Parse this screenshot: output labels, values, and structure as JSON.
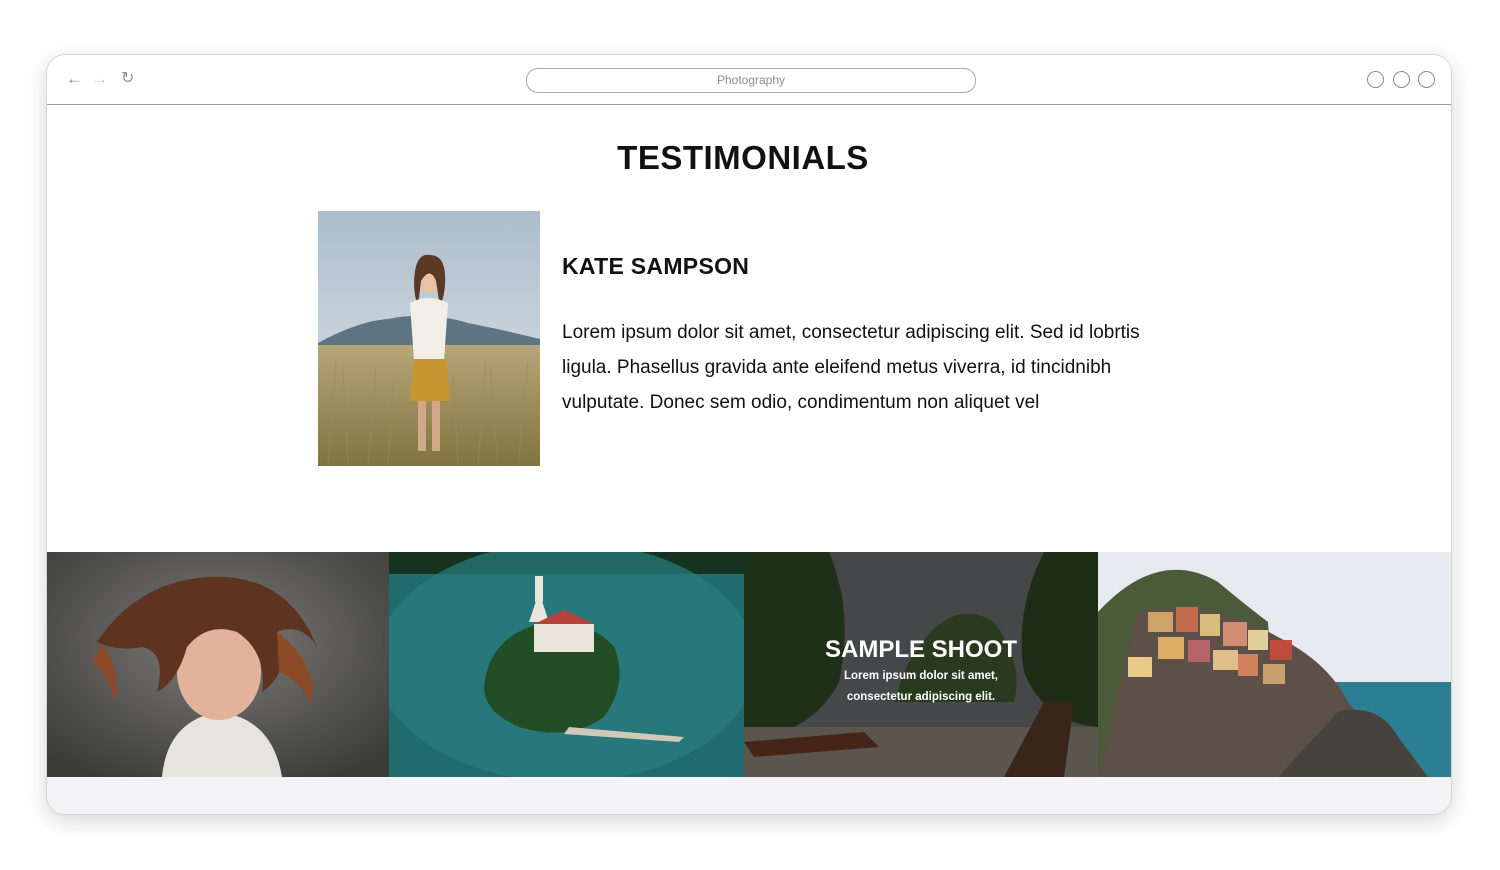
{
  "browser": {
    "address_text": "Photography",
    "back_icon": "arrow-left-icon",
    "forward_icon": "arrow-right-icon",
    "reload_icon": "reload-icon"
  },
  "testimonials": {
    "title": "TESTIMONIALS",
    "name": "KATE SAMPSON",
    "quote": "Lorem ipsum dolor sit amet, consectetur adipiscing elit. Sed id lobrtis ligula. Phasellus gravida ante eleifend metus viverra, id tincidnibh vulputate. Donec sem odio, condimentum non aliquet vel"
  },
  "gallery": {
    "featured": {
      "title": "SAMPLE SHOOT",
      "description": "Lorem ipsum dolor sit amet, consectetur adipiscing elit."
    }
  }
}
